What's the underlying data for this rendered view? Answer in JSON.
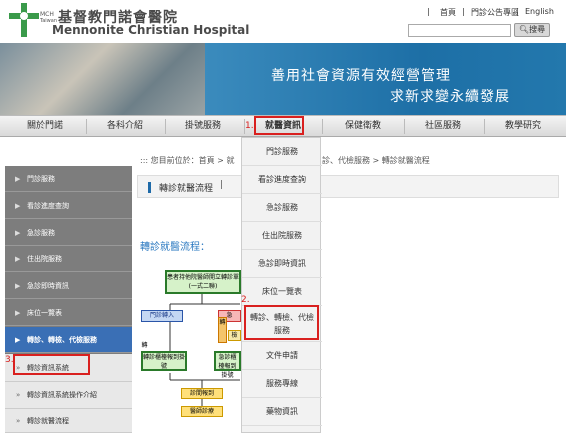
{
  "header": {
    "logo_cn": "基督教門諾會醫院",
    "logo_en": "Mennonite Christian Hospital",
    "logo_mark": "MCH",
    "logo_sub": "Taiwan",
    "top_links": [
      "首頁",
      "門診公告專區",
      "English"
    ],
    "search_button": "搜尋"
  },
  "banner": {
    "line1": "善用社會資源有效經營管理",
    "line2": "求新求變永續發展"
  },
  "nav": {
    "items": [
      "關於門諾",
      "各科介紹",
      "掛號服務",
      "就醫資訊",
      "保健衛教",
      "社區服務",
      "教學研究"
    ],
    "annotation_1": "1."
  },
  "breadcrumb": {
    "prefix": "::: 您目前位於：",
    "home": "首頁",
    "sep1": " > ",
    "hidden": "就",
    "visible_tail": "診、代檢服務 > 轉診就醫流程"
  },
  "page_title": "轉診就醫流程",
  "section_title": "轉診就醫流程：",
  "sidebar": {
    "items": [
      "門診服務",
      "看診進度查詢",
      "急診服務",
      "住出院服務",
      "急診即時資訊",
      "床位一覽表",
      "轉診、轉檢、代檢服務"
    ],
    "subitems": [
      "轉診資訊系統",
      "轉診資訊系統操作介紹",
      "轉診就醫流程"
    ],
    "annotation_3": "3."
  },
  "dropdown": {
    "items": [
      "門診服務",
      "看診進度查詢",
      "急診服務",
      "住出院服務",
      "急診即時資訊",
      "床位一覽表",
      "轉診、轉檢、代檢服務",
      "文件申請",
      "服務專線",
      "藥物資訊"
    ],
    "annotation_2": "2."
  },
  "flow": {
    "box1": "患者持他院醫師開立轉診單(一式二聯)",
    "box2": "門診轉入",
    "box3": "急",
    "box4": "檢",
    "box5": "轉",
    "box6": "轉",
    "box7": "轉診櫃檯報到掛號",
    "box8": "急診櫃檯報到掛號",
    "box9": "診間報到",
    "box10": "醫師診療"
  },
  "colors": {
    "accent_red": "#d9201f",
    "nav_blue": "#1e6aa8",
    "sidebar_gray": "#7d7d7d",
    "sidebar_active": "#3a6fb5"
  }
}
